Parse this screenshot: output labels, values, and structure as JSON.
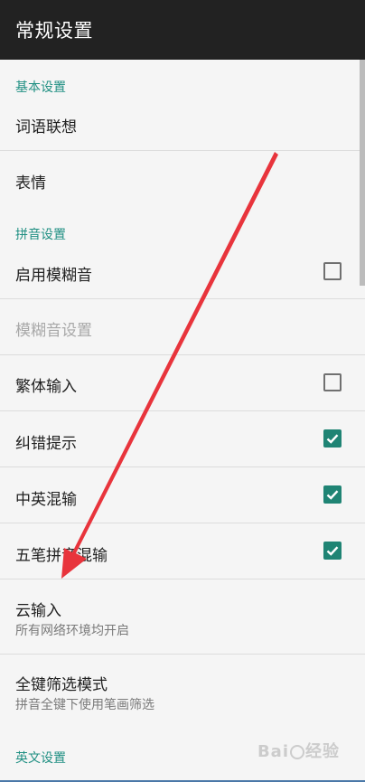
{
  "appbar": {
    "title": "常规设置"
  },
  "sections": {
    "basic": "基本设置",
    "pinyin": "拼音设置",
    "english": "英文设置"
  },
  "items": {
    "word_assoc": {
      "title": "词语联想"
    },
    "emoji": {
      "title": "表情"
    },
    "fuzzy_enable": {
      "title": "启用模糊音",
      "checked": false
    },
    "fuzzy_settings": {
      "title": "模糊音设置",
      "enabled": false
    },
    "traditional": {
      "title": "繁体输入",
      "checked": false
    },
    "correction": {
      "title": "纠错提示",
      "checked": true
    },
    "cn_en_mix": {
      "title": "中英混输",
      "checked": true
    },
    "wubi_pinyin_mix": {
      "title": "五笔拼音混输",
      "checked": true
    },
    "cloud_input": {
      "title": "云输入",
      "subtitle": "所有网络环境均开启"
    },
    "full_key_filter": {
      "title": "全键筛选模式",
      "subtitle": "拼音全键下使用笔画筛选"
    }
  },
  "watermark": {
    "text_a": "Bai",
    "text_b": "经验"
  },
  "colors": {
    "accent": "#1f8f82",
    "checkbox_on": "#1f8474",
    "arrow": "#e8343c",
    "appbar": "#222222"
  }
}
